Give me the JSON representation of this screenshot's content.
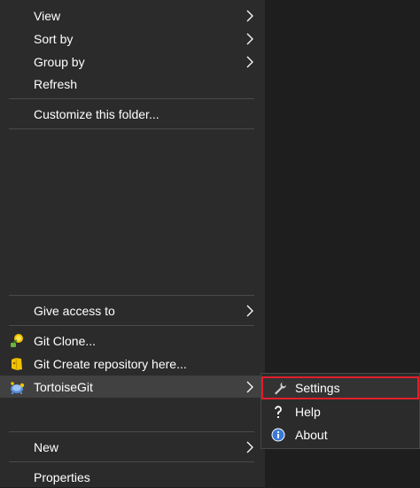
{
  "menu": {
    "items": [
      {
        "label": "View",
        "submenu": true
      },
      {
        "label": "Sort by",
        "submenu": true
      },
      {
        "label": "Group by",
        "submenu": true
      },
      {
        "label": "Refresh",
        "submenu": false
      },
      {
        "label": "Customize this folder...",
        "submenu": false
      },
      {
        "label": "Give access to",
        "submenu": true
      },
      {
        "label": "Git Clone...",
        "icon": "git-clone-icon"
      },
      {
        "label": "Git Create repository here...",
        "icon": "git-create-repo-icon"
      },
      {
        "label": "TortoiseGit",
        "icon": "tortoisegit-icon",
        "submenu": true
      },
      {
        "label": "New",
        "submenu": true
      },
      {
        "label": "Properties",
        "submenu": false
      }
    ]
  },
  "submenu": {
    "items": [
      {
        "label": "Settings",
        "icon": "wrench-icon"
      },
      {
        "label": "Help",
        "icon": "help-icon"
      },
      {
        "label": "About",
        "icon": "info-icon"
      }
    ]
  },
  "colors": {
    "menu_bg": "#2b2b2b",
    "highlight": "#414141",
    "separator": "#4a4a4a",
    "focus_outline": "#e21e2c"
  }
}
